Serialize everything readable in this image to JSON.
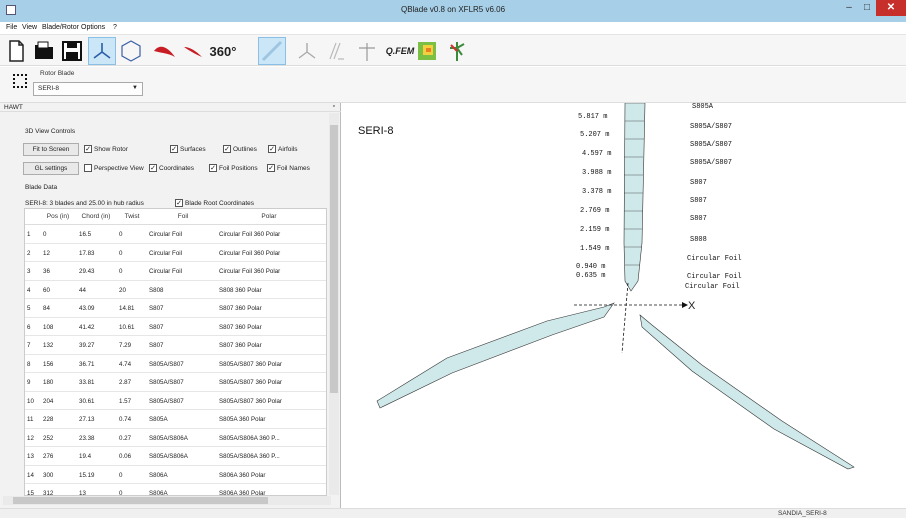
{
  "window": {
    "title": "QBlade v0.8 on XFLR5 v6.06",
    "minimize": "–",
    "maximize": "□",
    "close": "✕"
  },
  "menu": [
    "File",
    "View",
    "Blade/Rotor",
    "Options",
    "?"
  ],
  "toolbar": {
    "icons": [
      "new-file-icon",
      "open-file-icon",
      "save-icon",
      "rotor-icon",
      "circle-icon",
      "blade-icon",
      "blade2-icon",
      "360-text",
      "dock-icon",
      "hawt-icon",
      "vawt-icon",
      "turbine-icon",
      "qfem-text",
      "heatmap-icon",
      "windfield-icon"
    ],
    "label_360": "360°",
    "label_qfem": "Q.FEM"
  },
  "selector": {
    "label": "Rotor Blade",
    "value": "SERI-8"
  },
  "panel": {
    "title": "HAWT",
    "float_icon": "▫",
    "view_controls_title": "3D View Controls",
    "fit_to_screen": "Fit to Screen",
    "gl_settings": "GL settings",
    "checkboxes": {
      "show_rotor": {
        "label": "Show Rotor",
        "checked": true
      },
      "surfaces": {
        "label": "Surfaces",
        "checked": true
      },
      "outlines": {
        "label": "Outlines",
        "checked": true
      },
      "airfoils": {
        "label": "Airfoils",
        "checked": true
      },
      "perspective_view": {
        "label": "Perspective View",
        "checked": false
      },
      "coordinates": {
        "label": "Coordinates",
        "checked": true
      },
      "foil_positions": {
        "label": "Foil Positions",
        "checked": true
      },
      "foil_names": {
        "label": "Foil Names",
        "checked": true
      },
      "blade_root_coordinates": {
        "label": "Blade Root Coordinates",
        "checked": true
      }
    },
    "blade_data_title": "Blade Data",
    "blade_info": "SERI-8: 3 blades and 25.00 in hub radius"
  },
  "table": {
    "headers": [
      "",
      "Pos (in)",
      "Chord (in)",
      "Twist",
      "Foil",
      "Polar"
    ],
    "rows": [
      [
        "1",
        "0",
        "16.5",
        "0",
        "Circular Foil",
        "Circular Foil 360 Polar"
      ],
      [
        "2",
        "12",
        "17.83",
        "0",
        "Circular Foil",
        "Circular Foil 360 Polar"
      ],
      [
        "3",
        "36",
        "29.43",
        "0",
        "Circular Foil",
        "Circular Foil 360 Polar"
      ],
      [
        "4",
        "60",
        "44",
        "20",
        "S808",
        "S808 360 Polar"
      ],
      [
        "5",
        "84",
        "43.09",
        "14.81",
        "S807",
        "S807 360 Polar"
      ],
      [
        "6",
        "108",
        "41.42",
        "10.61",
        "S807",
        "S807 360 Polar"
      ],
      [
        "7",
        "132",
        "39.27",
        "7.29",
        "S807",
        "S807 360 Polar"
      ],
      [
        "8",
        "156",
        "36.71",
        "4.74",
        "S805A/S807",
        "S805A/S807 360 Polar"
      ],
      [
        "9",
        "180",
        "33.81",
        "2.87",
        "S805A/S807",
        "S805A/S807 360 Polar"
      ],
      [
        "10",
        "204",
        "30.61",
        "1.57",
        "S805A/S807",
        "S805A/S807 360 Polar"
      ],
      [
        "11",
        "228",
        "27.13",
        "0.74",
        "S805A",
        "S805A 360 Polar"
      ],
      [
        "12",
        "252",
        "23.38",
        "0.27",
        "S805A/S806A",
        "S805A/S806A 360 P..."
      ],
      [
        "13",
        "276",
        "19.4",
        "0.06",
        "S805A/S806A",
        "S805A/S806A 360 P..."
      ],
      [
        "14",
        "300",
        "15.19",
        "0",
        "S806A",
        "S806A 360 Polar"
      ],
      [
        "15",
        "312",
        "13",
        "0",
        "S806A",
        "S806A 360 Polar"
      ]
    ]
  },
  "view": {
    "blade_name": "SERI-8",
    "positions": [
      "5.817 m",
      "5.207 m",
      "4.597 m",
      "3.988 m",
      "3.378 m",
      "2.769 m",
      "2.159 m",
      "1.549 m",
      "0.940 m",
      "0.635 m"
    ],
    "foils": [
      "S805A",
      "S805A/S807",
      "S805A/S807",
      "S805A/S807",
      "S807",
      "S807",
      "S807",
      "S808",
      "Circular Foil",
      "Circular Foil",
      "Circular Foil"
    ],
    "axis_x": "X"
  },
  "status": {
    "text": "SANDIA_SERI-8"
  },
  "colors": {
    "titlebar": "#a7cfe7",
    "blade_fill": "#cfe8ea",
    "close": "#c7302a"
  }
}
